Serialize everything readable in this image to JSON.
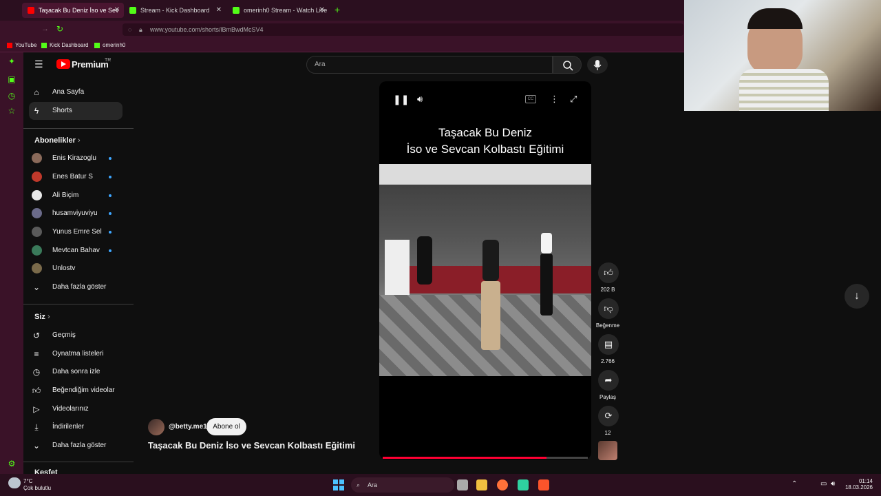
{
  "browser": {
    "tabs": [
      {
        "label": "Taşacak Bu Deniz İso ve Sev",
        "color": "#ff0000",
        "active": true
      },
      {
        "label": "Stream - Kick Dashboard",
        "color": "#53fc18",
        "active": false
      },
      {
        "label": "omerinh0 Stream - Watch Live o",
        "color": "#53fc18",
        "active": false
      }
    ],
    "url": "www.youtube.com/shorts/lBmBwdMcSV4",
    "bookmarks": [
      "YouTube",
      "Kick Dashboard",
      "omerinh0"
    ]
  },
  "youtube": {
    "logo": "Premium",
    "region": "TR",
    "search_placeholder": "Ara",
    "nav": [
      {
        "label": "Ana Sayfa",
        "icon": "home-icon"
      },
      {
        "label": "Shorts",
        "icon": "shorts-icon"
      }
    ],
    "subscriptions_header": "Abonelikler",
    "subscriptions": [
      {
        "label": "Enis Kirazoglu",
        "dot": true,
        "color": "#8a6a5a"
      },
      {
        "label": "Enes Batur S",
        "dot": true,
        "color": "#c0392b"
      },
      {
        "label": "Ali Biçim",
        "dot": true,
        "color": "#e8e8e8"
      },
      {
        "label": "husamviyuviyu",
        "dot": true,
        "color": "#6b6b8a"
      },
      {
        "label": "Yunus Emre Sel",
        "dot": true,
        "color": "#5a5a5a"
      },
      {
        "label": "Mevtcan Bahav",
        "dot": true,
        "color": "#3a7a5a"
      },
      {
        "label": "Unlostv",
        "dot": false,
        "color": "#7a6a4a"
      }
    ],
    "show_more": "Daha fazla göster",
    "you_header": "Siz",
    "you_items": [
      {
        "label": "Geçmiş",
        "icon": "history-icon"
      },
      {
        "label": "Oynatma listeleri",
        "icon": "playlist-icon"
      },
      {
        "label": "Daha sonra izle",
        "icon": "clock-icon"
      },
      {
        "label": "Beğendiğim videolar",
        "icon": "thumbs-up-icon"
      },
      {
        "label": "Videolarınız",
        "icon": "video-icon"
      },
      {
        "label": "İndirilenler",
        "icon": "download-icon"
      }
    ],
    "show_more_2": "Daha fazla göster",
    "explore_header": "Keşfet",
    "short": {
      "overlay_line1": "Taşacak Bu Deniz",
      "overlay_line2": "İso ve Sevcan Kolbastı Eğitimi",
      "channel": "@betty.me1",
      "subscribe": "Abone ol",
      "title": "Taşacak Bu Deniz İso ve Sevcan Kolbastı Eğitimi",
      "likes": "202 B",
      "dislike_label": "Beğenme",
      "comments": "2.766",
      "share_label": "Paylaş",
      "remix": "12",
      "progress": 0.8
    }
  },
  "taskbar": {
    "weather_temp": "7°C",
    "weather_desc": "Çok bulutlu",
    "search": "Ara",
    "time": "01:14",
    "date": "18.03.2026"
  }
}
